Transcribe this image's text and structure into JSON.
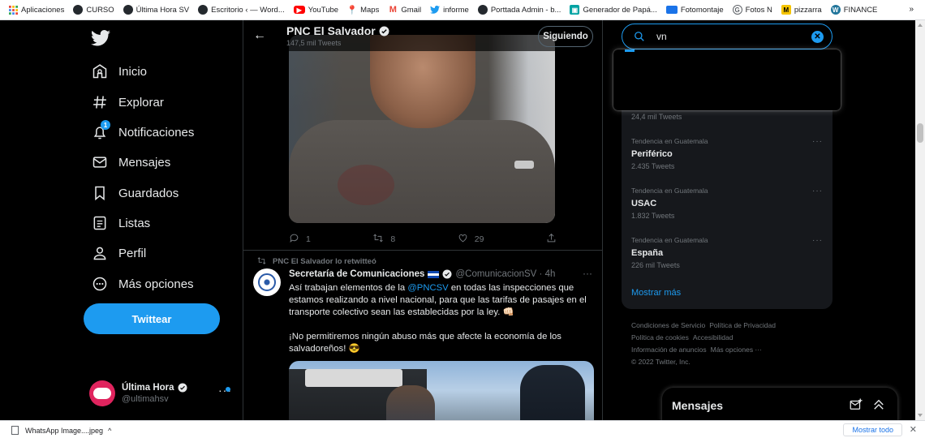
{
  "bookmarks": [
    {
      "label": "Aplicaciones",
      "icon": "apps-grid-icon",
      "color": "#ea4335"
    },
    {
      "label": "CURSO",
      "icon": "github-icon",
      "color": "#24292e"
    },
    {
      "label": "Última Hora SV",
      "icon": "github-icon",
      "color": "#24292e"
    },
    {
      "label": "Escritorio ‹ — Word...",
      "icon": "github-icon",
      "color": "#24292e"
    },
    {
      "label": "YouTube",
      "icon": "youtube-icon",
      "color": "#ff0000"
    },
    {
      "label": "Maps",
      "icon": "maps-icon",
      "color": "#34a853"
    },
    {
      "label": "Gmail",
      "icon": "gmail-icon",
      "color": "#ea4335"
    },
    {
      "label": "informe",
      "icon": "twitter-icon",
      "color": "#1d9bf0"
    },
    {
      "label": "Porttada Admin - b...",
      "icon": "github-icon",
      "color": "#24292e"
    },
    {
      "label": "Generador de Papá...",
      "icon": "gift-icon",
      "color": "#00a3a3"
    },
    {
      "label": "Fotomontaje",
      "icon": "monitor-icon",
      "color": "#1a73e8"
    },
    {
      "label": "Fotos N",
      "icon": "g-icon",
      "color": "#5f6368"
    },
    {
      "label": "pizzarra",
      "icon": "m-icon",
      "color": "#f5c400"
    },
    {
      "label": "FINANCE",
      "icon": "wordpress-icon",
      "color": "#21759b"
    }
  ],
  "bookmarks_overflow": "»",
  "nav": {
    "items": [
      {
        "label": "Inicio",
        "icon": "home-icon"
      },
      {
        "label": "Explorar",
        "icon": "hashtag-icon"
      },
      {
        "label": "Notificaciones",
        "icon": "bell-icon",
        "badge": "1"
      },
      {
        "label": "Mensajes",
        "icon": "mail-icon"
      },
      {
        "label": "Guardados",
        "icon": "bookmark-icon"
      },
      {
        "label": "Listas",
        "icon": "list-icon"
      },
      {
        "label": "Perfil",
        "icon": "person-icon"
      },
      {
        "label": "Más opciones",
        "icon": "more-circle-icon"
      }
    ],
    "tweet_button": "Twittear"
  },
  "account": {
    "name": "Última Hora",
    "handle": "@ultimahsv",
    "more": "···"
  },
  "profile_header": {
    "back": "←",
    "title": "PNC El Salvador",
    "subtitle": "147,5 mil Tweets",
    "follow_label": "Siguiendo"
  },
  "tweet1": {
    "replies": "1",
    "retweets": "8",
    "likes": "29"
  },
  "tweet2": {
    "retweeted_by": "PNC El Salvador lo retwitteó",
    "author": "Secretaría de Comunicaciones",
    "handle": "@ComunicacionSV · 4h",
    "more": "···",
    "text1_a": "Así trabajan elementos de la ",
    "text1_link": "@PNCSV",
    "text1_b": " en todas las inspecciones que estamos realizando a nivel nacional, para que las tarifas de pasajes en el transporte colectivo sean las establecidas por la ley. 👊🏻",
    "text2": "¡No permitiremos ningún abuso más que afecte la economía de los salvadoreños! 😎"
  },
  "search": {
    "value": "vn",
    "clear": "✕"
  },
  "trends": {
    "first_count": "24,4 mil Tweets",
    "items": [
      {
        "context": "Tendencia en Guatemala",
        "title": "Periférico",
        "count": "2.435 Tweets",
        "more": "···"
      },
      {
        "context": "Tendencia en Guatemala",
        "title": "USAC",
        "count": "1.832 Tweets",
        "more": "···"
      },
      {
        "context": "Tendencia en Guatemala",
        "title": "España",
        "count": "226 mil Tweets",
        "more": "···"
      }
    ],
    "show_more": "Mostrar más"
  },
  "footer": {
    "links": [
      "Condiciones de Servicio",
      "Política de Privacidad",
      "Política de cookies",
      "Accesibilidad",
      "Información de anuncios",
      "Más opciones ···"
    ],
    "copyright": "© 2022 Twitter, Inc."
  },
  "messages_panel": {
    "title": "Mensajes"
  },
  "download_shelf": {
    "file": "WhatsApp Image....jpeg",
    "chevron": "^",
    "show_all": "Mostrar todo",
    "close": "✕"
  },
  "colors": {
    "accent": "#1d9bf0",
    "background": "#000000",
    "card": "#16181c",
    "muted": "#71767b"
  }
}
